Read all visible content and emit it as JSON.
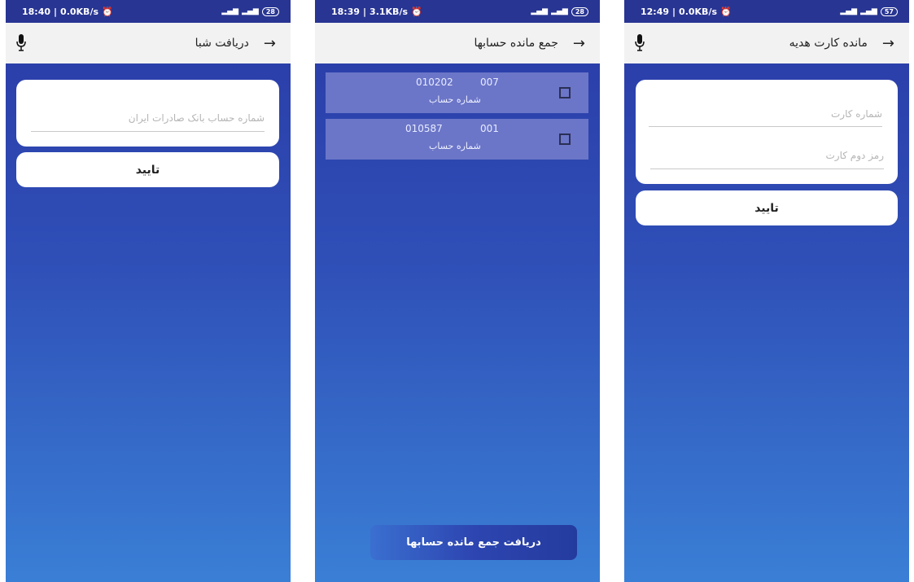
{
  "screens": [
    {
      "status": {
        "time": "18:40",
        "speed": "0.0KB/s",
        "battery": "28"
      },
      "title": "دریافت شبا",
      "field_placeholder": "شماره حساب بانک صادرات ایران",
      "confirm_label": "تایید"
    },
    {
      "status": {
        "time": "18:39",
        "speed": "3.1KB/s",
        "battery": "28"
      },
      "title": "جمع مانده حسابها",
      "accounts": [
        {
          "number_a": "010202",
          "number_b": "007",
          "label": "شماره حساب"
        },
        {
          "number_a": "010587",
          "number_b": "001",
          "label": "شماره حساب"
        }
      ],
      "bottom_button_label": "دریافت جمع مانده حسابها"
    },
    {
      "status": {
        "time": "12:49",
        "speed": "0.0KB/s",
        "battery": "57"
      },
      "title": "مانده کارت هدیه",
      "card_number_placeholder": "شماره کارت",
      "card_pin_placeholder": "رمز دوم کارت",
      "confirm_label": "تایید"
    }
  ],
  "icons": {
    "back": "arrow-right-icon",
    "mic": "microphone-icon",
    "alarm": "alarm-icon",
    "signal": "signal-icon",
    "checkbox": "checkbox-icon"
  },
  "colors": {
    "statusbar": "#283593",
    "appbar": "#f2f2f2",
    "gradient_top": "#2a3aa6",
    "gradient_bottom": "#3a7fd6",
    "account_row": "#6b76c8"
  }
}
